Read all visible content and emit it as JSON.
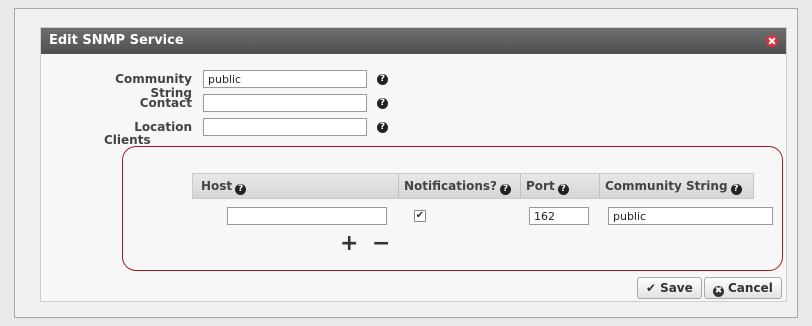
{
  "dialog": {
    "title": "Edit SNMP Service",
    "close_icon": "close-circle-icon"
  },
  "form": {
    "community_string": {
      "label": "Community String",
      "value": "public"
    },
    "contact": {
      "label": "Contact",
      "value": ""
    },
    "location": {
      "label": "Location",
      "value": ""
    },
    "help_icon": "question-circle-icon"
  },
  "clients": {
    "label": "Clients",
    "columns": [
      "Host",
      "Notifications?",
      "Port",
      "Community String"
    ],
    "rows": [
      {
        "host": "",
        "notifications": true,
        "port": "162",
        "community_string": "public"
      }
    ],
    "add_symbol": "+",
    "remove_symbol": "−"
  },
  "actions": {
    "save_label": "Save",
    "save_icon": "✔",
    "cancel_label": "Cancel",
    "cancel_icon": "✖"
  },
  "colors": {
    "highlight": "#9c1c22",
    "titlebar": "#5a5a5a",
    "close": "#d9343a"
  }
}
